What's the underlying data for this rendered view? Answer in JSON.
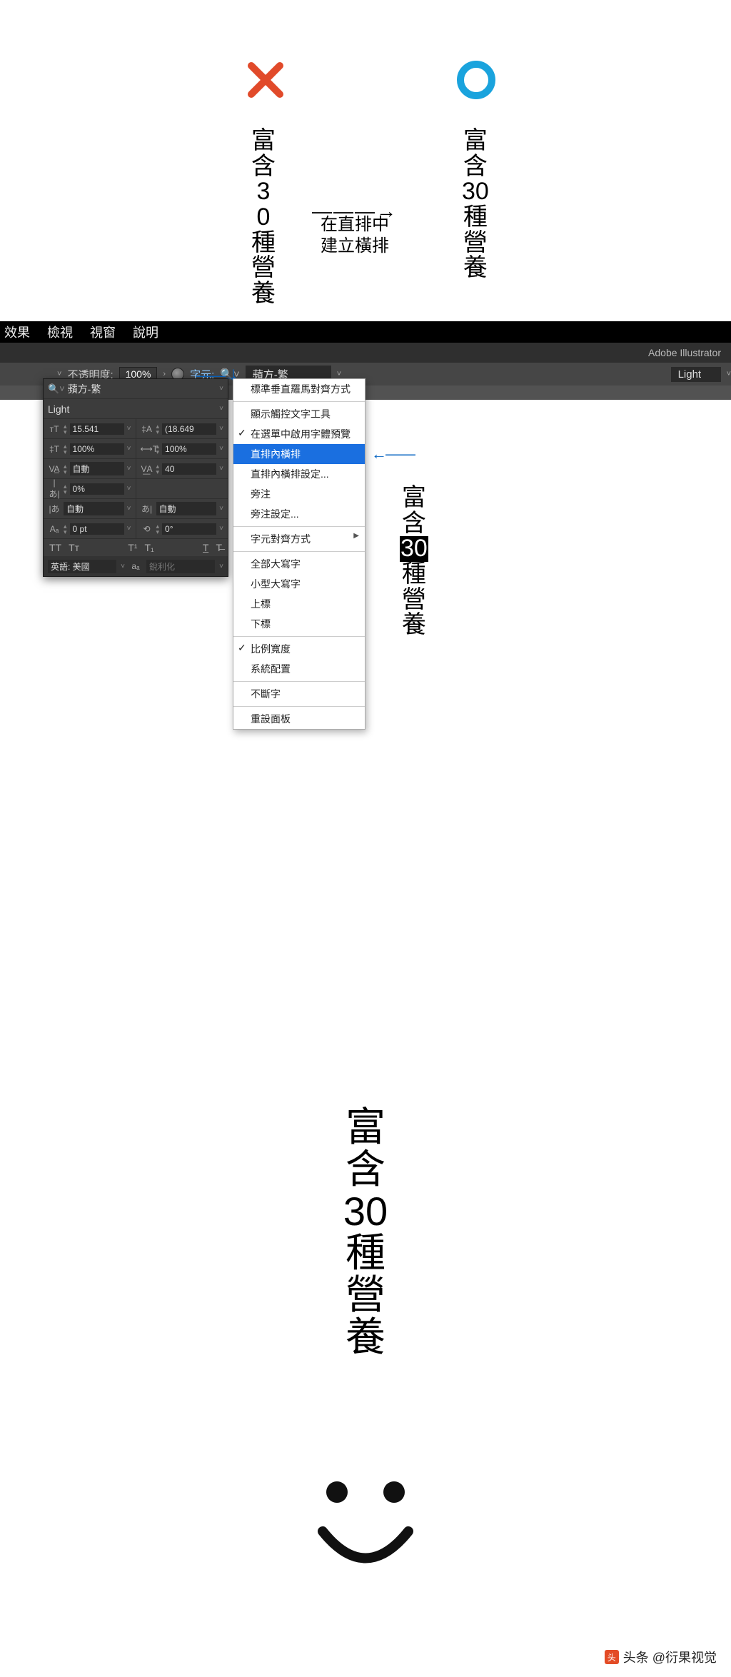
{
  "top": {
    "annot_line1": "在直排中",
    "annot_line2": "建立橫排",
    "arrow": "———→",
    "wrong": [
      "富",
      "含",
      "3",
      "0",
      "種",
      "營",
      "養"
    ],
    "correct": [
      "富",
      "含",
      "30",
      "種",
      "營",
      "養"
    ]
  },
  "menubar": [
    "效果",
    "檢視",
    "視窗",
    "說明"
  ],
  "app_name": "Adobe Illustrator",
  "ctrl": {
    "opacity_label": "不透明度:",
    "opacity_value": "100%",
    "char_label": "字元:",
    "font_name": "蘋方-繁",
    "weight": "Light"
  },
  "panel": {
    "font_name": "蘋方-繁",
    "weight": "Light",
    "size": "15.541",
    "leading": "(18.649",
    "hscale": "100%",
    "vscale": "100%",
    "kerning": "自動",
    "tracking": "40",
    "baseline_pct": "0%",
    "aki_l": "自動",
    "aki_r": "自動",
    "baseline_shift": "0 pt",
    "rotation": "0°",
    "lang": "英語: 美國",
    "aa": "銳利化"
  },
  "menu": {
    "items": [
      {
        "label": "標準垂直羅馬對齊方式"
      },
      {
        "sep": true
      },
      {
        "label": "顯示觸控文字工具"
      },
      {
        "label": "在選單中啟用字體預覽",
        "checked": true
      },
      {
        "label": "直排內橫排",
        "selected": true
      },
      {
        "label": "直排內橫排設定..."
      },
      {
        "label": "旁注"
      },
      {
        "label": "旁注設定..."
      },
      {
        "sep": true
      },
      {
        "label": "字元對齊方式",
        "submenu": true
      },
      {
        "sep": true
      },
      {
        "label": "全部大寫字"
      },
      {
        "label": "小型大寫字"
      },
      {
        "label": "上標"
      },
      {
        "label": "下標"
      },
      {
        "sep": true
      },
      {
        "label": "比例寬度",
        "checked": true
      },
      {
        "label": "系統配置"
      },
      {
        "sep": true
      },
      {
        "label": "不斷字"
      },
      {
        "sep": true
      },
      {
        "label": "重設面板"
      }
    ]
  },
  "sample": [
    "富",
    "含",
    "30",
    "種",
    "營",
    "養"
  ],
  "result": [
    "富",
    "含",
    "30",
    "種",
    "營",
    "養"
  ],
  "watermark": "头条 @衍果视觉"
}
